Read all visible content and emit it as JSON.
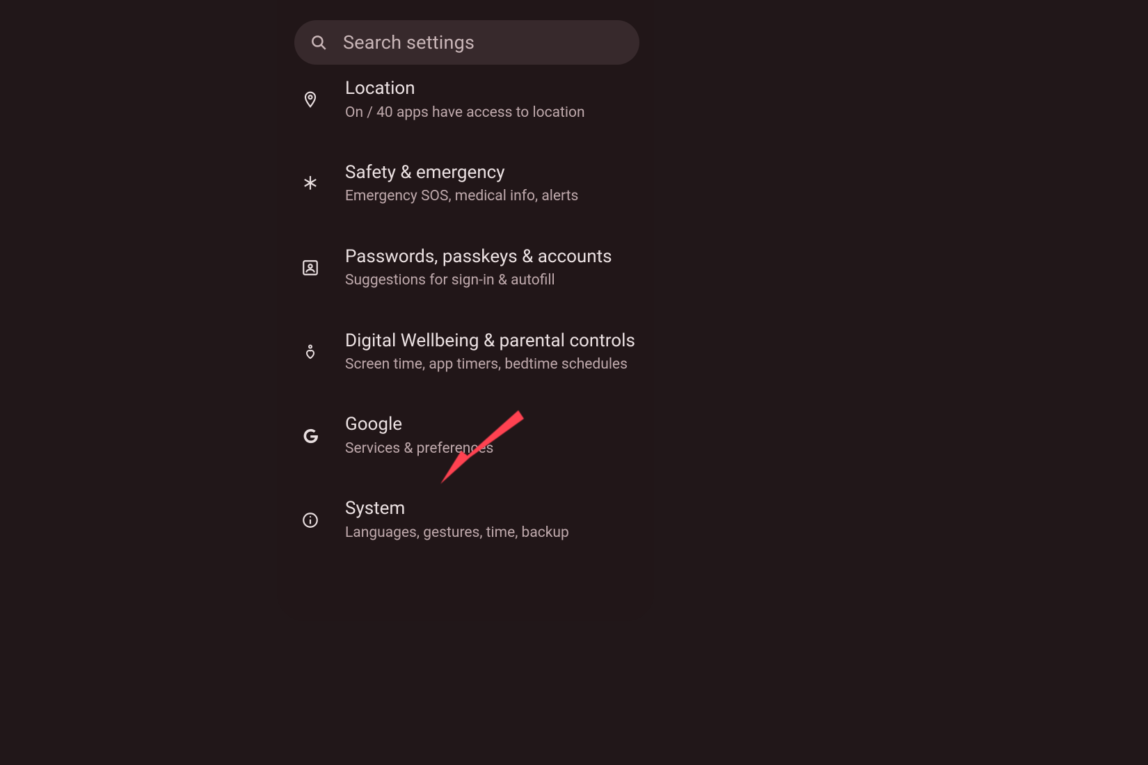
{
  "search": {
    "placeholder": "Search settings"
  },
  "settings": [
    {
      "title": "Location",
      "subtitle": "On / 40 apps have access to location",
      "icon": "location-pin-icon"
    },
    {
      "title": "Safety & emergency",
      "subtitle": "Emergency SOS, medical info, alerts",
      "icon": "asterisk-icon"
    },
    {
      "title": "Passwords, passkeys & accounts",
      "subtitle": "Suggestions for sign-in & autofill",
      "icon": "account-box-icon"
    },
    {
      "title": "Digital Wellbeing & parental controls",
      "subtitle": "Screen time, app timers, bedtime schedules",
      "icon": "wellbeing-icon"
    },
    {
      "title": "Google",
      "subtitle": "Services & preferences",
      "icon": "google-g-icon"
    },
    {
      "title": "System",
      "subtitle": "Languages, gestures, time, backup",
      "icon": "info-circle-icon"
    }
  ],
  "annotation": {
    "arrow_target": "settings-item-google",
    "color": "#ff4351"
  }
}
